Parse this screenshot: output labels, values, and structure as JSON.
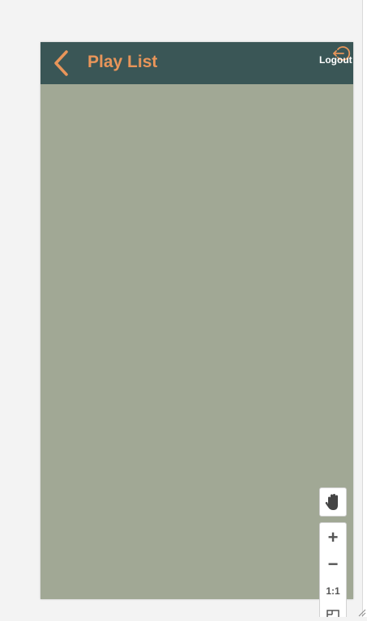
{
  "header": {
    "title": "Play List",
    "back_icon": "chevron-left-icon",
    "logout_label": "Logout",
    "logout_icon": "logout-icon"
  },
  "colors": {
    "header_bg": "#3a5656",
    "accent": "#e8955a",
    "content_bg": "#a1a895",
    "page_bg": "#f3f3f3"
  },
  "tools": {
    "pan_icon": "hand-icon",
    "zoom_in_label": "+",
    "zoom_out_label": "−",
    "actual_size_label": "1:1",
    "fit_icon": "fit-screen-icon"
  }
}
